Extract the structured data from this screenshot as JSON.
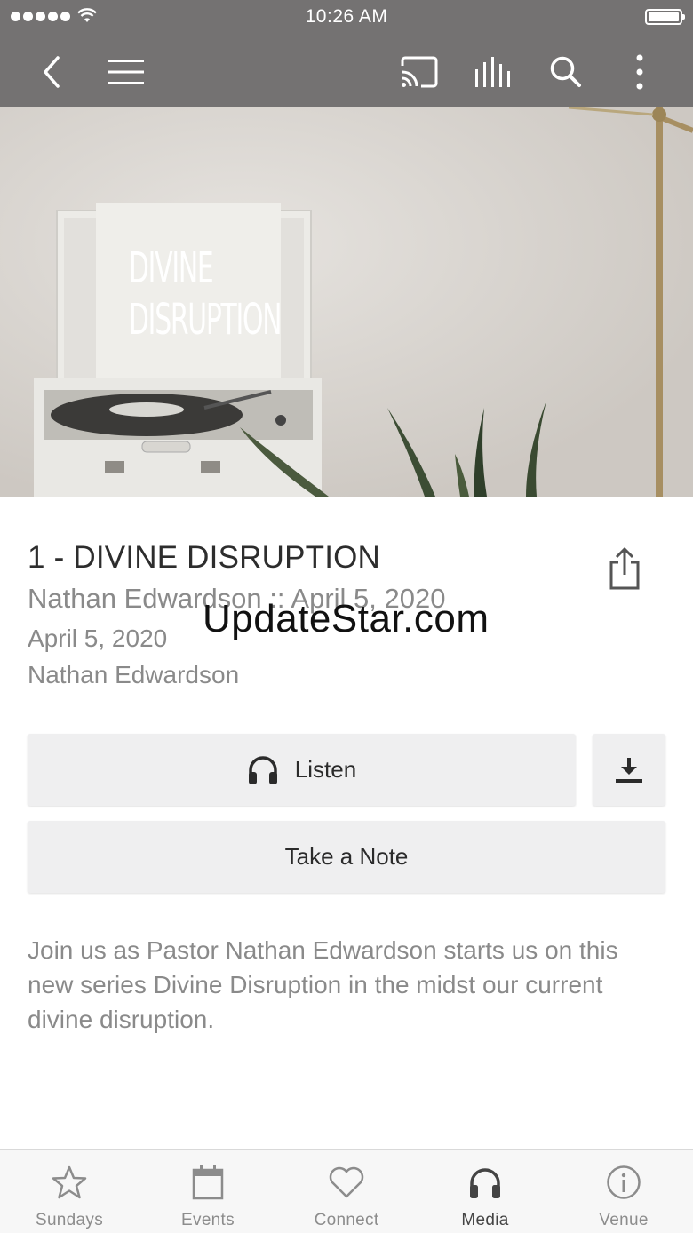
{
  "status_bar": {
    "time": "10:26 AM"
  },
  "hero": {
    "artwork_line1": "DIVINE",
    "artwork_line2": "DISRUPTION"
  },
  "sermon": {
    "title": "1 - DIVINE DISRUPTION",
    "subtitle": "Nathan Edwardson :: April 5, 2020",
    "date": "April 5, 2020",
    "speaker": "Nathan Edwardson",
    "description": "Join us as Pastor Nathan Edwardson starts us on this new series Divine Disruption in the midst our current divine disruption."
  },
  "watermark": "UpdateStar.com",
  "actions": {
    "listen_label": "Listen",
    "note_label": "Take a Note"
  },
  "tabs": [
    {
      "label": "Sundays",
      "icon": "star-icon"
    },
    {
      "label": "Events",
      "icon": "calendar-icon"
    },
    {
      "label": "Connect",
      "icon": "heart-icon"
    },
    {
      "label": "Media",
      "icon": "headphones-icon",
      "active": true
    },
    {
      "label": "Venue",
      "icon": "info-icon"
    }
  ],
  "colors": {
    "toolbar": "#747272",
    "button_bg": "#efeff0",
    "muted_text": "#8a8a8a"
  }
}
